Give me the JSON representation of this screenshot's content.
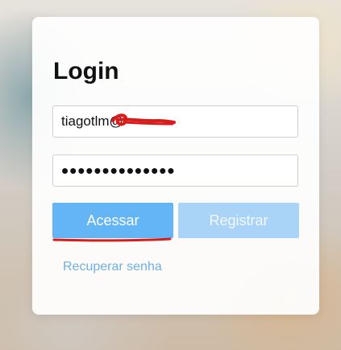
{
  "login": {
    "title": "Login",
    "email_value": "tiagotlm@",
    "password_value": "••••••••••••••",
    "access_button": "Acessar",
    "register_button": "Registrar",
    "recover_link": "Recuperar senha"
  },
  "annotation": {
    "color": "#d81b1b"
  }
}
